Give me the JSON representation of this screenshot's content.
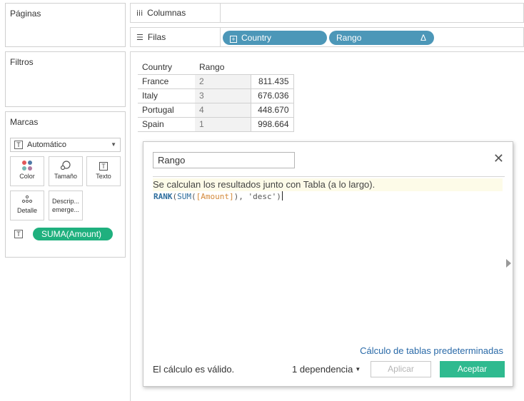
{
  "panels": {
    "pages_title": "Páginas",
    "filters_title": "Filtros",
    "marks_title": "Marcas",
    "mark_type": "Automático",
    "mark_cards": [
      {
        "icon": "color-icon",
        "label": "Color"
      },
      {
        "icon": "size-icon",
        "label": "Tamaño"
      },
      {
        "icon": "text-icon",
        "label": "Texto"
      },
      {
        "icon": "detail-icon",
        "label": "Detalle"
      },
      {
        "icon": "tooltip-icon",
        "label": "Descrip... emerge..."
      }
    ],
    "text_mark_icon_glyph": "T",
    "measure_pill": "SUMA(Amount)"
  },
  "shelves": {
    "columns_label": "Columnas",
    "rows_label": "Filas",
    "columns_icon_glyph": "iii",
    "rows_icon_glyph": "☰",
    "row_pills": [
      {
        "label": "Country",
        "prefix_glyph": "+"
      },
      {
        "label": "Rango",
        "suffix_glyph": "Δ"
      }
    ]
  },
  "table": {
    "headers": [
      "Country",
      "Rango"
    ],
    "rows": [
      {
        "country": "France",
        "rango": "2",
        "value": "811.435"
      },
      {
        "country": "Italy",
        "rango": "3",
        "value": "676.036"
      },
      {
        "country": "Portugal",
        "rango": "4",
        "value": "448.670"
      },
      {
        "country": "Spain",
        "rango": "1",
        "value": "998.664"
      }
    ]
  },
  "dialog": {
    "calc_name": "Rango",
    "close_glyph": "✕",
    "hint": "Se calculan los resultados junto con Tabla (a lo largo).",
    "formula": {
      "fn1": "RANK",
      "p1": "(",
      "fn2": "SUM",
      "p2": "(",
      "field": "[Amount]",
      "p3": "), ",
      "str": "'desc'",
      "p4": ")"
    },
    "default_table_calc_link": "Cálculo de tablas predeterminadas",
    "status": "El cálculo es válido.",
    "dependencies": "1 dependencia",
    "apply_button": "Aplicar",
    "ok_button": "Aceptar"
  },
  "colors": {
    "pill_blue": "#4c97b8",
    "pill_green": "#1fb07e",
    "ok_button": "#2fba8f",
    "link": "#2a6aa8"
  }
}
